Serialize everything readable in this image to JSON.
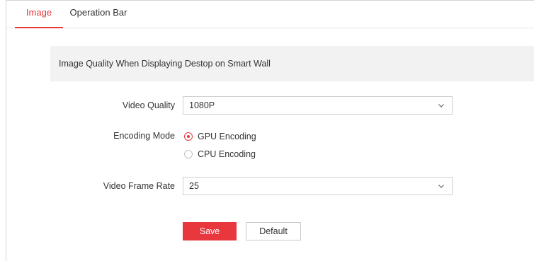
{
  "tabs": [
    {
      "label": "Image",
      "active": true
    },
    {
      "label": "Operation Bar",
      "active": false
    }
  ],
  "section": {
    "title": "Image Quality When Displaying Destop on Smart Wall"
  },
  "form": {
    "video_quality": {
      "label": "Video Quality",
      "value": "1080P",
      "icon": "chevron-down-icon"
    },
    "encoding_mode": {
      "label": "Encoding Mode",
      "options": [
        {
          "label": "GPU Encoding",
          "checked": true
        },
        {
          "label": "CPU Encoding",
          "checked": false
        }
      ]
    },
    "frame_rate": {
      "label": "Video Frame Rate",
      "value": "25",
      "icon": "chevron-down-icon"
    }
  },
  "buttons": {
    "save_label": "Save",
    "default_label": "Default"
  },
  "colors": {
    "accent": "#e8383d",
    "section_bg": "#f2f2f2",
    "border": "#cfcfcf"
  }
}
